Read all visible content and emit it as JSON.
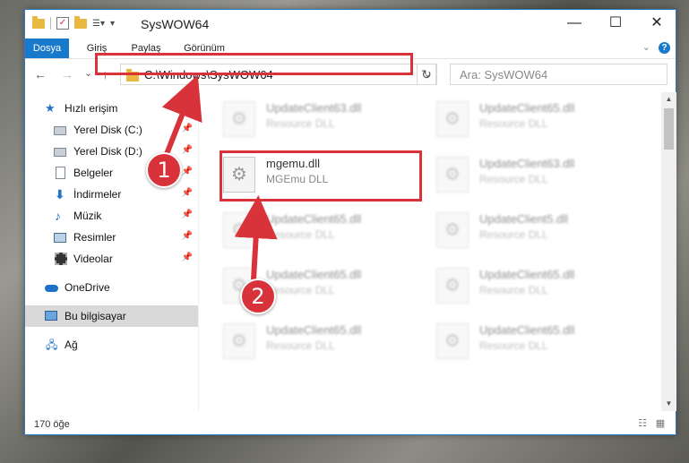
{
  "window": {
    "title": "SysWOW64",
    "minimize_glyph": "—",
    "maximize_glyph": "☐",
    "close_glyph": "✕"
  },
  "ribbon": {
    "tabs": [
      "Dosya",
      "Giriş",
      "Paylaş",
      "Görünüm"
    ],
    "help": "?"
  },
  "navbar": {
    "back": "←",
    "forward": "→",
    "recent": "⌄",
    "up": "↑",
    "address": "C:\\Windows\\SysWOW64",
    "refresh": "↻",
    "search_placeholder": "Ara: SysWOW64"
  },
  "sidebar": {
    "items": [
      {
        "label": "Hızlı erişim",
        "icon": "star-icon",
        "pinned": false
      },
      {
        "label": "Yerel Disk (C:)",
        "icon": "drive-icon",
        "pinned": true
      },
      {
        "label": "Yerel Disk (D:)",
        "icon": "drive-icon",
        "pinned": true
      },
      {
        "label": "Belgeler",
        "icon": "document-icon",
        "pinned": true
      },
      {
        "label": "İndirmeler",
        "icon": "download-icon",
        "pinned": true
      },
      {
        "label": "Müzik",
        "icon": "music-icon",
        "pinned": true
      },
      {
        "label": "Resimler",
        "icon": "pictures-icon",
        "pinned": true
      },
      {
        "label": "Videolar",
        "icon": "video-icon",
        "pinned": true
      },
      {
        "label": "OneDrive",
        "icon": "cloud-icon",
        "pinned": false
      },
      {
        "label": "Bu bilgisayar",
        "icon": "computer-icon",
        "pinned": false,
        "selected": true
      },
      {
        "label": "Ağ",
        "icon": "network-icon",
        "pinned": false
      }
    ],
    "pin_glyph": "📌"
  },
  "files": [
    {
      "name": "UpdateClient63.dll",
      "type": "Resource DLL",
      "blurred": true
    },
    {
      "name": "UpdateClient65.dll",
      "type": "Resource DLL",
      "blurred": true
    },
    {
      "name": "mgemu.dll",
      "type": "MGEmu DLL",
      "blurred": false
    },
    {
      "name": "UpdateClient63.dll",
      "type": "Resource DLL",
      "blurred": true
    },
    {
      "name": "UpdateClient65.dll",
      "type": "Resource DLL",
      "blurred": true
    },
    {
      "name": "UpdateClient5.dll",
      "type": "Resource DLL",
      "blurred": true
    },
    {
      "name": "UpdateClient65.dll",
      "type": "Resource DLL",
      "blurred": true
    },
    {
      "name": "UpdateClient65.dll",
      "type": "Resource DLL",
      "blurred": true
    },
    {
      "name": "UpdateClient65.dll",
      "type": "Resource DLL",
      "blurred": true
    },
    {
      "name": "UpdateClient65.dll",
      "type": "Resource DLL",
      "blurred": true
    }
  ],
  "status": {
    "count": "170 öğe"
  },
  "callouts": [
    "1",
    "2"
  ],
  "colors": {
    "accent": "#1979ca",
    "highlight": "#d8333b"
  }
}
